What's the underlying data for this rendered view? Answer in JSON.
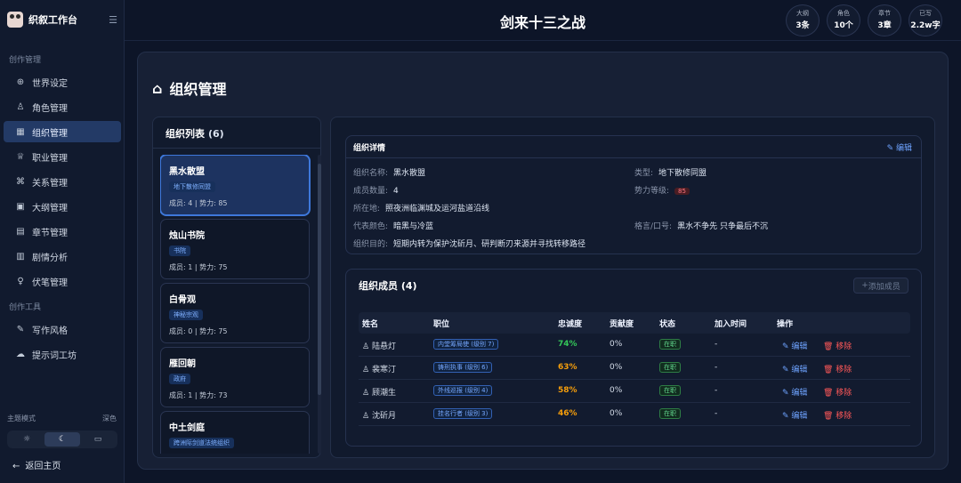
{
  "brand": {
    "name": "织叙工作台",
    "menu_icon": "menu-icon"
  },
  "sidebar": {
    "sections": [
      {
        "label": "创作管理"
      },
      {
        "label": "创作工具"
      }
    ],
    "items": [
      {
        "label": "世界设定",
        "icon": "globe-icon"
      },
      {
        "label": "角色管理",
        "icon": "users-icon"
      },
      {
        "label": "组织管理",
        "icon": "organization-icon",
        "active": true
      },
      {
        "label": "职业管理",
        "icon": "trophy-icon"
      },
      {
        "label": "关系管理",
        "icon": "relation-icon"
      },
      {
        "label": "大纲管理",
        "icon": "outline-icon"
      },
      {
        "label": "章节管理",
        "icon": "chapter-icon"
      },
      {
        "label": "剧情分析",
        "icon": "chart-icon"
      },
      {
        "label": "伏笔管理",
        "icon": "lightbulb-icon"
      },
      {
        "label": "写作风格",
        "icon": "pen-icon"
      },
      {
        "label": "提示词工坊",
        "icon": "cloud-icon"
      }
    ],
    "theme_label": "主题模式",
    "theme_value": "深色",
    "theme_options": [
      {
        "icon": "sun-icon",
        "active": false
      },
      {
        "icon": "moon-icon",
        "active": true
      },
      {
        "icon": "monitor-icon",
        "active": false
      }
    ],
    "back_label": "返回主页"
  },
  "header": {
    "novel_title": "剑来十三之战",
    "stats": [
      {
        "label": "大纲",
        "value": "3条"
      },
      {
        "label": "角色",
        "value": "10个"
      },
      {
        "label": "章节",
        "value": "3章"
      },
      {
        "label": "已写",
        "value": "2.2w字"
      }
    ]
  },
  "page": {
    "title": "组织管理",
    "title_icon": "organization-icon"
  },
  "org_list": {
    "title": "组织列表",
    "count": "(6)",
    "items": [
      {
        "name": "黑水散盟",
        "tag": "地下散修同盟",
        "meta": "成员: 4 | 势力: 85",
        "selected": true
      },
      {
        "name": "烛山书院",
        "tag": "书院",
        "meta": "成员: 1 | 势力: 75"
      },
      {
        "name": "白骨观",
        "tag": "神秘宗观",
        "meta": "成员: 0 | 势力: 75"
      },
      {
        "name": "雁回朝",
        "tag": "政府",
        "meta": "成员: 1 | 势力: 73"
      },
      {
        "name": "中土剑庭",
        "tag": "跨洲际剑道法统组织",
        "meta": ""
      }
    ]
  },
  "detail": {
    "section_title": "组织详情",
    "edit_label": "编辑",
    "fields": {
      "name_key": "组织名称:",
      "name_value": "黑水散盟",
      "type_key": "类型:",
      "type_value": "地下散修同盟",
      "members_key": "成员数量:",
      "members_value": "4",
      "power_key": "势力等级:",
      "power_value": "85",
      "location_key": "所在地:",
      "location_value": "照夜洲临渊城及运河盐道沿线",
      "color_key": "代表颜色:",
      "color_value": "暗黑与冷蓝",
      "motto_key": "格言/口号:",
      "motto_value": "黑水不争先 只争最后不沉",
      "goal_key": "组织目的:",
      "goal_value": "短期内转为保护沈斫月、研判断刃来源并寻找转移路径"
    }
  },
  "members": {
    "title": "组织成员",
    "count": "(4)",
    "add_label": "添加成员",
    "columns": [
      "姓名",
      "职位",
      "忠诚度",
      "贡献度",
      "状态",
      "加入时间",
      "操作"
    ],
    "rows": [
      {
        "name": "陆悬灯",
        "role": "内堂筹局使 (级别 7)",
        "loyalty": "74%",
        "contribution": "0%",
        "status": "在职",
        "joined": "-",
        "edit": "编辑",
        "remove": "移除"
      },
      {
        "name": "裴寒汀",
        "role": "铸刑执事 (级别 6)",
        "loyalty": "63%",
        "contribution": "0%",
        "status": "在职",
        "joined": "-",
        "edit": "编辑",
        "remove": "移除"
      },
      {
        "name": "顾潮生",
        "role": "外线巡报 (级别 4)",
        "loyalty": "58%",
        "contribution": "0%",
        "status": "在职",
        "joined": "-",
        "edit": "编辑",
        "remove": "移除"
      },
      {
        "name": "沈斫月",
        "role": "挂名行者 (级别 3)",
        "loyalty": "46%",
        "contribution": "0%",
        "status": "在职",
        "joined": "-",
        "edit": "编辑",
        "remove": "移除"
      }
    ]
  },
  "colors": {
    "accent": "#3e78db",
    "active_nav": "#233a66",
    "danger": "#ff5858",
    "success": "#34c759",
    "warning": "#f59e0b"
  }
}
